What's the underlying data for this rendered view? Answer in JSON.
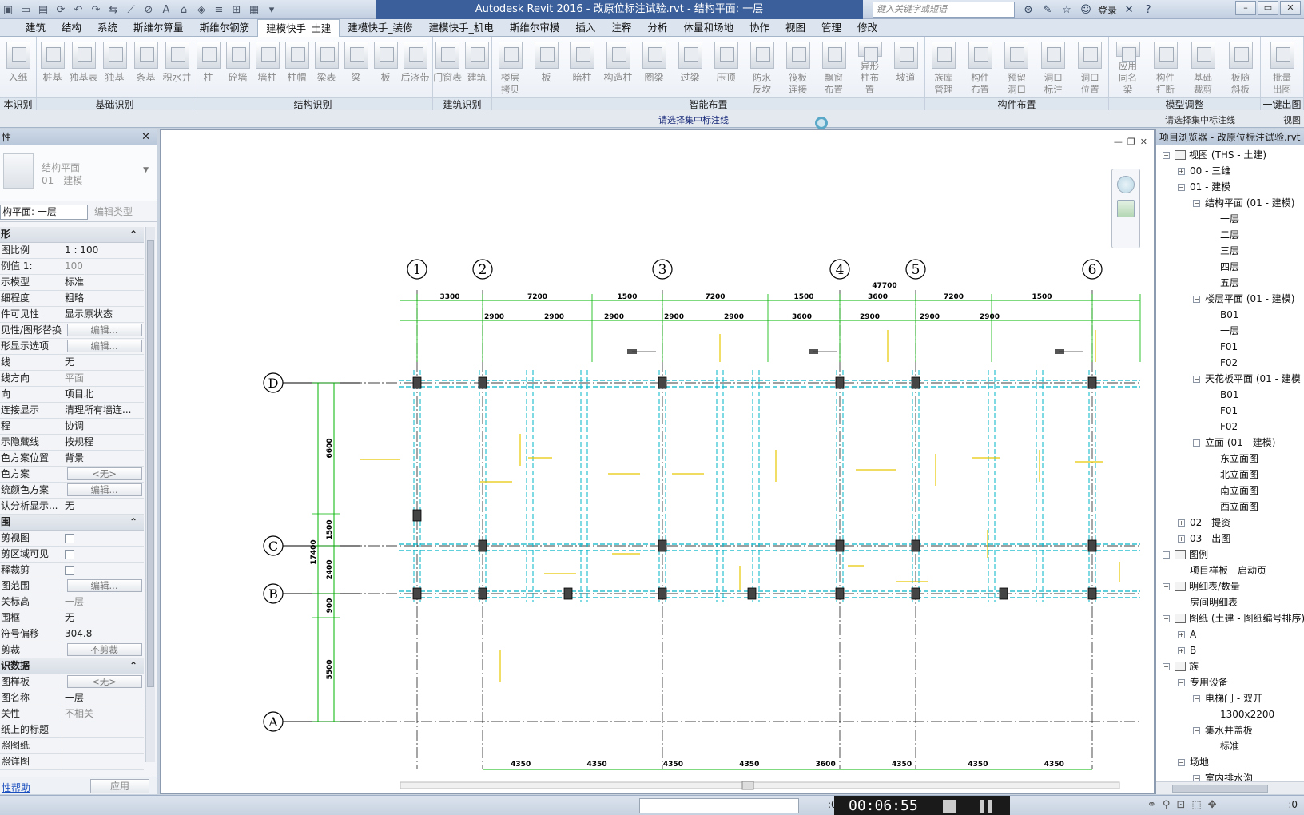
{
  "titlebar": {
    "title": "Autodesk Revit 2016 -   改原位标注试验.rvt - 结构平面: 一层",
    "search_placeholder": "键入关键字或短语",
    "login": "登录",
    "qat_icons": [
      "open-icon",
      "save-icon",
      "sync-icon",
      "undo-icon",
      "redo-icon",
      "measure-icon",
      "dimension-icon",
      "text-icon",
      "3d-icon",
      "section-icon",
      "thin-lines-icon",
      "switch-window-icon",
      "dropdown-icon"
    ]
  },
  "tabs": [
    "建筑",
    "结构",
    "系统",
    "斯维尔算量",
    "斯维尔钢筋",
    "建模快手_土建",
    "建模快手_装修",
    "建模快手_机电",
    "斯维尔审模",
    "插入",
    "注释",
    "分析",
    "体量和场地",
    "协作",
    "视图",
    "管理",
    "修改"
  ],
  "active_tab": "建模快手_土建",
  "ribbon": {
    "groups": [
      {
        "label": "本识别",
        "buttons": [
          "入纸"
        ]
      },
      {
        "label": "基础识别",
        "buttons": [
          "桩基",
          "独基表",
          "独基",
          "条基",
          "积水井"
        ]
      },
      {
        "label": "结构识别",
        "buttons": [
          "柱",
          "砼墙",
          "墙柱",
          "柱帽",
          "梁表",
          "梁",
          "板",
          "后浇带"
        ]
      },
      {
        "label": "建筑识别",
        "buttons": [
          "门窗表",
          "建筑"
        ]
      },
      {
        "label": "智能布置",
        "buttons": [
          "楼层拷贝",
          "板",
          "暗柱",
          "构造柱",
          "圈梁",
          "过梁",
          "压顶",
          "防水反坎",
          "筏板连接",
          "飘窗布置",
          "异形柱布置",
          "坡道"
        ]
      },
      {
        "label": "构件布置",
        "buttons": [
          "族库管理",
          "构件布置",
          "预留洞口",
          "洞口标注",
          "洞口位置"
        ]
      },
      {
        "label": "模型调整",
        "buttons": [
          "应用同名梁",
          "构件打断",
          "基础裁剪",
          "板随斜板"
        ]
      },
      {
        "label": "一键出图",
        "buttons": [
          "批量出图"
        ]
      }
    ]
  },
  "hintbar": {
    "left": "请选择集中标注线",
    "right": "请选择集中标注线",
    "view": "视图"
  },
  "properties": {
    "header": "性",
    "type_name_1": "结构平面",
    "type_name_2": "01 - 建模",
    "instance": "构平面: 一层",
    "edit_type": "编辑类型",
    "sections": [
      {
        "title": "形",
        "rows": [
          {
            "name": "图比例",
            "value": "1 : 100",
            "kind": "text"
          },
          {
            "name": "例值 1:",
            "value": "100",
            "kind": "grey"
          },
          {
            "name": "示模型",
            "value": "标准",
            "kind": "text"
          },
          {
            "name": "细程度",
            "value": "粗略",
            "kind": "text"
          },
          {
            "name": "件可见性",
            "value": "显示原状态",
            "kind": "text"
          },
          {
            "name": "见性/图形替换",
            "value": "编辑...",
            "kind": "btn"
          },
          {
            "name": "形显示选项",
            "value": "编辑...",
            "kind": "btn"
          },
          {
            "name": "线",
            "value": "无",
            "kind": "text"
          },
          {
            "name": "线方向",
            "value": "平面",
            "kind": "grey"
          },
          {
            "name": "向",
            "value": "项目北",
            "kind": "text"
          },
          {
            "name": "连接显示",
            "value": "清理所有墙连...",
            "kind": "text"
          },
          {
            "name": "程",
            "value": "协调",
            "kind": "text"
          },
          {
            "name": "示隐藏线",
            "value": "按规程",
            "kind": "text"
          },
          {
            "name": "色方案位置",
            "value": "背景",
            "kind": "text"
          },
          {
            "name": "色方案",
            "value": "<无>",
            "kind": "btn"
          },
          {
            "name": "统颜色方案",
            "value": "编辑...",
            "kind": "btn"
          },
          {
            "name": "认分析显示...",
            "value": "无",
            "kind": "text"
          }
        ]
      },
      {
        "title": "围",
        "rows": [
          {
            "name": "剪视图",
            "value": "",
            "kind": "chk"
          },
          {
            "name": "剪区域可见",
            "value": "",
            "kind": "chk"
          },
          {
            "name": "释裁剪",
            "value": "",
            "kind": "chk"
          },
          {
            "name": "图范围",
            "value": "编辑...",
            "kind": "btn"
          },
          {
            "name": "关标高",
            "value": "一层",
            "kind": "grey"
          },
          {
            "name": "围框",
            "value": "无",
            "kind": "text"
          },
          {
            "name": "符号偏移",
            "value": "304.8",
            "kind": "text"
          },
          {
            "name": "剪裁",
            "value": "不剪裁",
            "kind": "btn"
          }
        ]
      },
      {
        "title": "识数据",
        "rows": [
          {
            "name": "图样板",
            "value": "<无>",
            "kind": "btn"
          },
          {
            "name": "图名称",
            "value": "一层",
            "kind": "text"
          },
          {
            "name": "关性",
            "value": "不相关",
            "kind": "grey"
          },
          {
            "name": "纸上的标题",
            "value": "",
            "kind": "text"
          },
          {
            "name": "照图纸",
            "value": "",
            "kind": "grey"
          },
          {
            "name": "照详图",
            "value": "",
            "kind": "grey"
          }
        ]
      }
    ],
    "help": "性帮助",
    "apply": "应用"
  },
  "drawing": {
    "axes_v": [
      "1",
      "2",
      "3",
      "4",
      "5",
      "6"
    ],
    "axes_h": [
      "D",
      "C",
      "B",
      "A"
    ],
    "dims_top_1": [
      "3300",
      "7200",
      "1500",
      "7200",
      "1500",
      "3600",
      "7200",
      "1500"
    ],
    "dims_top_2": [
      "2900",
      "2900",
      "2900",
      "2900",
      "2900",
      "3600",
      "2900",
      "2900",
      "2900"
    ],
    "dims_bottom": [
      "4350",
      "4350",
      "4350",
      "4350",
      "3600",
      "4350",
      "4350",
      "4350"
    ],
    "dims_left": [
      "6600",
      "1500",
      "2400",
      "900",
      "5500"
    ],
    "dim_left_total": "17400",
    "dim_top_extra": "47700",
    "colors": {
      "axis": "#000000",
      "dim": "#00b400",
      "beam": "#00b4c8",
      "label": "#e6c800"
    }
  },
  "browser": {
    "header": "项目浏览器 - 改原位标注试验.rvt",
    "nodes": [
      {
        "level": 0,
        "toggle": "-",
        "icon": true,
        "label": "视图 (THS - 土建)"
      },
      {
        "level": 1,
        "toggle": "+",
        "label": "00 - 三维"
      },
      {
        "level": 1,
        "toggle": "-",
        "label": "01 - 建模"
      },
      {
        "level": 2,
        "toggle": "-",
        "label": "结构平面 (01 - 建模)"
      },
      {
        "level": 3,
        "label": "一层"
      },
      {
        "level": 3,
        "label": "二层"
      },
      {
        "level": 3,
        "label": "三层"
      },
      {
        "level": 3,
        "label": "四层"
      },
      {
        "level": 3,
        "label": "五层"
      },
      {
        "level": 2,
        "toggle": "-",
        "label": "楼层平面 (01 - 建模)"
      },
      {
        "level": 3,
        "label": "B01"
      },
      {
        "level": 3,
        "label": "一层"
      },
      {
        "level": 3,
        "label": "F01"
      },
      {
        "level": 3,
        "label": "F02"
      },
      {
        "level": 2,
        "toggle": "-",
        "label": "天花板平面 (01 - 建模"
      },
      {
        "level": 3,
        "label": "B01"
      },
      {
        "level": 3,
        "label": "F01"
      },
      {
        "level": 3,
        "label": "F02"
      },
      {
        "level": 2,
        "toggle": "-",
        "label": "立面 (01 - 建模)"
      },
      {
        "level": 3,
        "label": "东立面图"
      },
      {
        "level": 3,
        "label": "北立面图"
      },
      {
        "level": 3,
        "label": "南立面图"
      },
      {
        "level": 3,
        "label": "西立面图"
      },
      {
        "level": 1,
        "toggle": "+",
        "label": "02 - 提资"
      },
      {
        "level": 1,
        "toggle": "+",
        "label": "03 - 出图"
      },
      {
        "level": 0,
        "toggle": "-",
        "icon": true,
        "label": "图例"
      },
      {
        "level": 1,
        "label": "项目样板 - 启动页"
      },
      {
        "level": 0,
        "toggle": "-",
        "icon": true,
        "label": "明细表/数量"
      },
      {
        "level": 1,
        "label": "房间明细表"
      },
      {
        "level": 0,
        "toggle": "-",
        "icon": true,
        "label": "图纸 (土建 - 图纸编号排序)"
      },
      {
        "level": 1,
        "toggle": "+",
        "label": "A"
      },
      {
        "level": 1,
        "toggle": "+",
        "label": "B"
      },
      {
        "level": 0,
        "toggle": "-",
        "icon": true,
        "label": "族"
      },
      {
        "level": 1,
        "toggle": "-",
        "label": "专用设备"
      },
      {
        "level": 2,
        "toggle": "-",
        "label": "电梯门 - 双开"
      },
      {
        "level": 3,
        "label": "1300x2200"
      },
      {
        "level": 2,
        "toggle": "-",
        "label": "集水井盖板"
      },
      {
        "level": 3,
        "label": "标准"
      },
      {
        "level": 1,
        "toggle": "-",
        "label": "场地"
      },
      {
        "level": 2,
        "toggle": "-",
        "label": "室内排水沟"
      }
    ]
  },
  "statusbar": {
    "zero": ":0",
    "timer": "00:06:55",
    "filter": ":0"
  }
}
